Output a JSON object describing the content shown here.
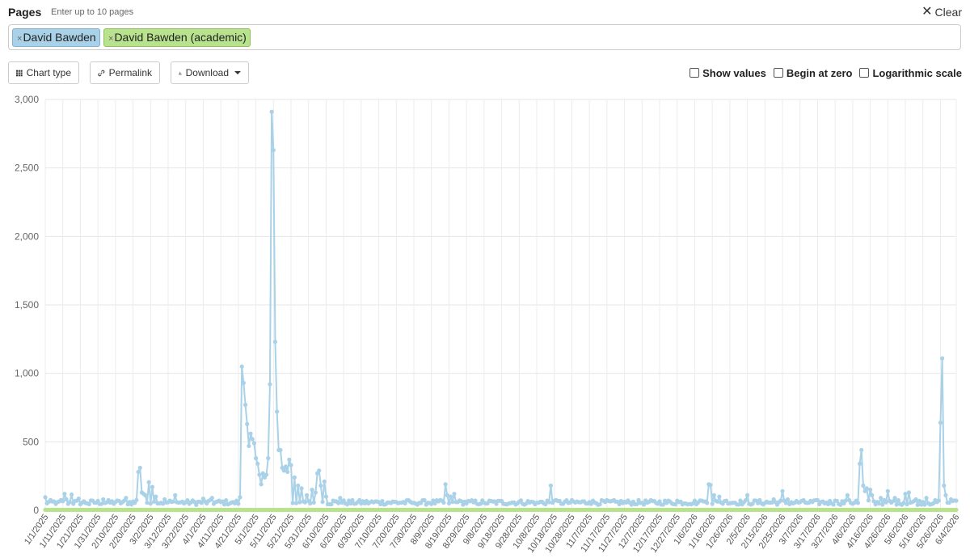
{
  "header": {
    "title": "Pages",
    "hint": "Enter up to 10 pages",
    "clear_label": "Clear"
  },
  "tags": [
    {
      "label": "David Bawden",
      "color": "#a9d1e7"
    },
    {
      "label": "David Bawden (academic)",
      "color": "#b8e28d"
    }
  ],
  "toolbar": {
    "chart_type_label": "Chart type",
    "permalink_label": "Permalink",
    "download_label": "Download"
  },
  "options": {
    "show_values": {
      "label": "Show values",
      "checked": false
    },
    "begin_at_zero": {
      "label": "Begin at zero",
      "checked": false
    },
    "log_scale": {
      "label": "Logarithmic scale",
      "checked": false
    }
  },
  "chart_data": {
    "type": "line",
    "ylim": [
      0,
      3000
    ],
    "yticks": [
      0,
      500,
      1000,
      1500,
      2000,
      2500,
      3000
    ],
    "ytick_labels": [
      "0",
      "500",
      "1,000",
      "1,500",
      "2,000",
      "2,500",
      "3,000"
    ],
    "x_start": "2025-01-01",
    "x_end": "2026-06-04",
    "xtick_labels": [
      "1/1/2025",
      "1/11/2025",
      "1/21/2025",
      "1/31/2025",
      "2/10/2025",
      "2/20/2025",
      "3/2/2025",
      "3/12/2025",
      "3/22/2025",
      "4/1/2025",
      "4/11/2025",
      "4/21/2025",
      "5/1/2025",
      "5/11/2025",
      "5/21/2025",
      "5/31/2025",
      "6/10/2025",
      "6/20/2025",
      "6/30/2025",
      "7/10/2025",
      "7/20/2025",
      "7/30/2025",
      "8/9/2025",
      "8/19/2025",
      "8/29/2025",
      "9/8/2025",
      "9/18/2025",
      "9/28/2025",
      "10/8/2025",
      "10/18/2025",
      "10/28/2025",
      "11/7/2025",
      "11/17/2025",
      "11/27/2025",
      "12/7/2025",
      "12/17/2025",
      "12/27/2025",
      "1/6/2026",
      "1/16/2026",
      "1/26/2026",
      "2/5/2026",
      "2/15/2026",
      "2/25/2026",
      "3/7/2026",
      "3/17/2026",
      "3/27/2026",
      "4/6/2026",
      "4/16/2026",
      "4/26/2026",
      "5/6/2026",
      "5/16/2026",
      "5/26/2026",
      "6/4/2026"
    ],
    "grid": true,
    "series": [
      {
        "name": "David Bawden",
        "color": "#a9d1e7",
        "baseline": 55,
        "points": [
          [
            "2025-01-01",
            95
          ],
          [
            "2025-01-08",
            60
          ],
          [
            "2025-01-10",
            75
          ],
          [
            "2025-01-12",
            120
          ],
          [
            "2025-01-13",
            80
          ],
          [
            "2025-01-16",
            115
          ],
          [
            "2025-01-20",
            85
          ],
          [
            "2025-01-26",
            45
          ],
          [
            "2025-02-03",
            80
          ],
          [
            "2025-02-10",
            60
          ],
          [
            "2025-02-16",
            90
          ],
          [
            "2025-02-22",
            75
          ],
          [
            "2025-02-23",
            280
          ],
          [
            "2025-02-24",
            310
          ],
          [
            "2025-02-25",
            130
          ],
          [
            "2025-02-26",
            120
          ],
          [
            "2025-02-27",
            110
          ],
          [
            "2025-03-01",
            205
          ],
          [
            "2025-03-03",
            170
          ],
          [
            "2025-03-05",
            100
          ],
          [
            "2025-03-10",
            80
          ],
          [
            "2025-03-16",
            110
          ],
          [
            "2025-03-22",
            60
          ],
          [
            "2025-04-01",
            85
          ],
          [
            "2025-04-06",
            90
          ],
          [
            "2025-04-18",
            60
          ],
          [
            "2025-04-22",
            95
          ],
          [
            "2025-04-23",
            1050
          ],
          [
            "2025-04-24",
            930
          ],
          [
            "2025-04-25",
            770
          ],
          [
            "2025-04-26",
            630
          ],
          [
            "2025-04-27",
            470
          ],
          [
            "2025-04-28",
            560
          ],
          [
            "2025-04-29",
            520
          ],
          [
            "2025-04-30",
            490
          ],
          [
            "2025-05-01",
            380
          ],
          [
            "2025-05-02",
            340
          ],
          [
            "2025-05-03",
            260
          ],
          [
            "2025-05-04",
            190
          ],
          [
            "2025-05-05",
            270
          ],
          [
            "2025-05-06",
            240
          ],
          [
            "2025-05-07",
            260
          ],
          [
            "2025-05-08",
            380
          ],
          [
            "2025-05-09",
            920
          ],
          [
            "2025-05-10",
            2910
          ],
          [
            "2025-05-11",
            2630
          ],
          [
            "2025-05-12",
            1230
          ],
          [
            "2025-05-13",
            720
          ],
          [
            "2025-05-14",
            440
          ],
          [
            "2025-05-15",
            440
          ],
          [
            "2025-05-16",
            310
          ],
          [
            "2025-05-17",
            290
          ],
          [
            "2025-05-18",
            320
          ],
          [
            "2025-05-19",
            280
          ],
          [
            "2025-05-20",
            370
          ],
          [
            "2025-05-21",
            330
          ],
          [
            "2025-05-23",
            240
          ],
          [
            "2025-05-25",
            180
          ],
          [
            "2025-05-27",
            160
          ],
          [
            "2025-05-30",
            110
          ],
          [
            "2025-06-02",
            150
          ],
          [
            "2025-06-04",
            130
          ],
          [
            "2025-06-05",
            270
          ],
          [
            "2025-06-06",
            290
          ],
          [
            "2025-06-07",
            180
          ],
          [
            "2025-06-09",
            210
          ],
          [
            "2025-06-10",
            100
          ],
          [
            "2025-06-14",
            70
          ],
          [
            "2025-06-18",
            90
          ],
          [
            "2025-06-24",
            50
          ],
          [
            "2025-07-10",
            60
          ],
          [
            "2025-07-30",
            55
          ],
          [
            "2025-08-15",
            70
          ],
          [
            "2025-08-17",
            190
          ],
          [
            "2025-08-18",
            110
          ],
          [
            "2025-08-20",
            100
          ],
          [
            "2025-08-22",
            120
          ],
          [
            "2025-08-24",
            60
          ],
          [
            "2025-09-08",
            55
          ],
          [
            "2025-10-08",
            55
          ],
          [
            "2025-10-14",
            70
          ],
          [
            "2025-10-16",
            180
          ],
          [
            "2025-10-18",
            70
          ],
          [
            "2025-11-07",
            60
          ],
          [
            "2025-12-07",
            55
          ],
          [
            "2025-12-27",
            70
          ],
          [
            "2026-01-10",
            70
          ],
          [
            "2026-01-14",
            190
          ],
          [
            "2026-01-15",
            185
          ],
          [
            "2026-01-17",
            110
          ],
          [
            "2026-01-20",
            100
          ],
          [
            "2026-01-24",
            70
          ],
          [
            "2026-02-05",
            110
          ],
          [
            "2026-02-10",
            70
          ],
          [
            "2026-02-20",
            80
          ],
          [
            "2026-02-25",
            140
          ],
          [
            "2026-02-28",
            80
          ],
          [
            "2026-03-07",
            60
          ],
          [
            "2026-03-27",
            70
          ],
          [
            "2026-04-03",
            110
          ],
          [
            "2026-04-08",
            70
          ],
          [
            "2026-04-10",
            340
          ],
          [
            "2026-04-11",
            440
          ],
          [
            "2026-04-12",
            180
          ],
          [
            "2026-04-13",
            140
          ],
          [
            "2026-04-14",
            160
          ],
          [
            "2026-04-16",
            150
          ],
          [
            "2026-04-17",
            110
          ],
          [
            "2026-04-22",
            90
          ],
          [
            "2026-04-26",
            140
          ],
          [
            "2026-04-30",
            90
          ],
          [
            "2026-05-06",
            120
          ],
          [
            "2026-05-08",
            130
          ],
          [
            "2026-05-12",
            80
          ],
          [
            "2026-05-18",
            90
          ],
          [
            "2026-05-24",
            60
          ],
          [
            "2026-05-26",
            640
          ],
          [
            "2026-05-27",
            1110
          ],
          [
            "2026-05-28",
            180
          ],
          [
            "2026-05-29",
            110
          ],
          [
            "2026-06-01",
            80
          ],
          [
            "2026-06-04",
            70
          ]
        ]
      },
      {
        "name": "David Bawden (academic)",
        "color": "#b8e28d",
        "baseline": 3,
        "points": []
      }
    ]
  }
}
